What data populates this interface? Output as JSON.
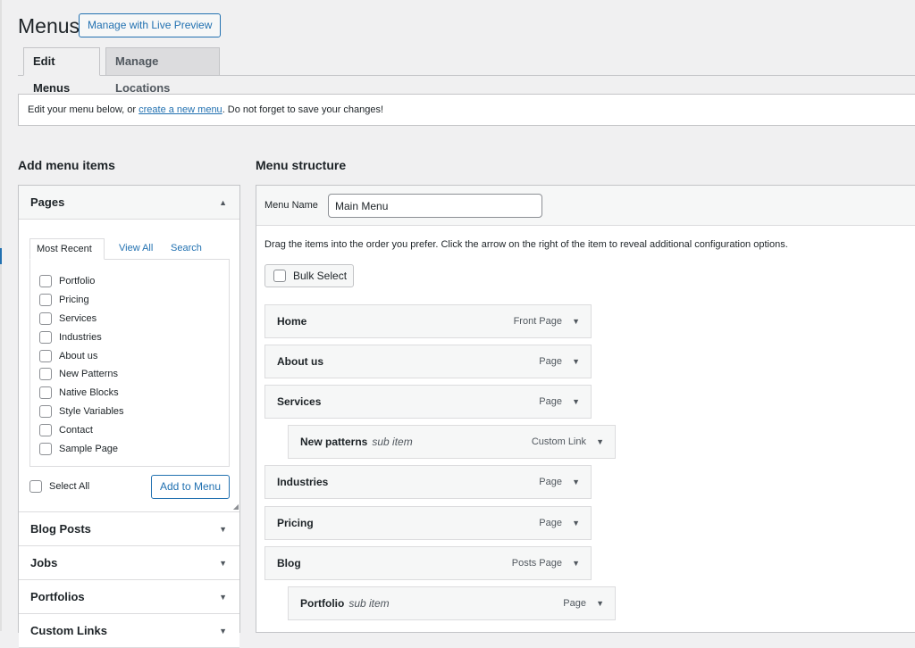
{
  "header": {
    "title": "Menus",
    "live_preview_label": "Manage with Live Preview",
    "tabs": [
      {
        "label": "Edit Menus"
      },
      {
        "label": "Manage Locations"
      }
    ]
  },
  "notice": {
    "text_before": "Edit your menu below, or ",
    "link_text": "create a new menu",
    "text_after": ". Do not forget to save your changes!"
  },
  "add_items": {
    "heading": "Add menu items",
    "pages": {
      "title": "Pages",
      "tabs": [
        "Most Recent",
        "View All",
        "Search"
      ],
      "items": [
        "Portfolio",
        "Pricing",
        "Services",
        "Industries",
        "About us",
        "New Patterns",
        "Native Blocks",
        "Style Variables",
        "Contact",
        "Sample Page"
      ],
      "select_all_label": "Select All",
      "add_button_label": "Add to Menu"
    },
    "sections": [
      "Blog Posts",
      "Jobs",
      "Portfolios",
      "Custom Links"
    ]
  },
  "structure": {
    "heading": "Menu structure",
    "menu_name_label": "Menu Name",
    "menu_name_value": "Main Menu",
    "instructions": "Drag the items into the order you prefer. Click the arrow on the right of the item to reveal additional configuration options.",
    "bulk_select_label": "Bulk Select",
    "items": [
      {
        "title": "Home",
        "type": "Front Page",
        "sub": false,
        "subtag": ""
      },
      {
        "title": "About us",
        "type": "Page",
        "sub": false,
        "subtag": ""
      },
      {
        "title": "Services",
        "type": "Page",
        "sub": false,
        "subtag": ""
      },
      {
        "title": "New patterns",
        "type": "Custom Link",
        "sub": true,
        "subtag": "sub item"
      },
      {
        "title": "Industries",
        "type": "Page",
        "sub": false,
        "subtag": ""
      },
      {
        "title": "Pricing",
        "type": "Page",
        "sub": false,
        "subtag": ""
      },
      {
        "title": "Blog",
        "type": "Posts Page",
        "sub": false,
        "subtag": ""
      },
      {
        "title": "Portfolio",
        "type": "Page",
        "sub": true,
        "subtag": "sub item"
      }
    ]
  }
}
